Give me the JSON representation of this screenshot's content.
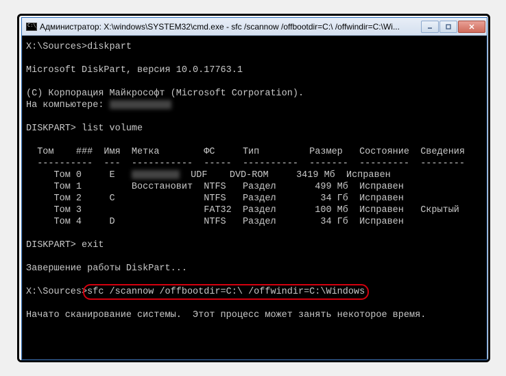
{
  "window": {
    "title": "Администратор: X:\\windows\\SYSTEM32\\cmd.exe - sfc /scannow /offbootdir=C:\\ /offwindir=C:\\Wi..."
  },
  "terminal": {
    "prompt1": "X:\\Sources>",
    "cmd1": "diskpart",
    "diskpart_header": "Microsoft DiskPart, версия 10.0.17763.1",
    "copyright": "(C) Корпорация Майкрософт (Microsoft Corporation).",
    "on_computer_label": "На компьютере: ",
    "diskpart_prompt1": "DISKPART> ",
    "diskpart_cmd1": "list volume",
    "table_header": "  Том    ###  Имя  Метка        ФС     Тип         Размер   Состояние  Сведения",
    "table_separator": "  ----------  ---  -----------  -----  ----------  -------  ---------  --------",
    "rows": [
      {
        "text_before": "     Том 0     E   ",
        "text_after": "  UDF    DVD-ROM     3419 Мб  Исправен"
      },
      {
        "text_before": "     Том 1         Восстановит  NTFS   Раздел       499 Мб  Исправен",
        "text_after": ""
      },
      {
        "text_before": "     Том 2     C                NTFS   Раздел        34 Гб  Исправен",
        "text_after": ""
      },
      {
        "text_before": "     Том 3                      FAT32  Раздел       100 Мб  Исправен   Скрытый",
        "text_after": ""
      },
      {
        "text_before": "     Том 4     D                NTFS   Раздел        34 Гб  Исправен",
        "text_after": ""
      }
    ],
    "diskpart_prompt2": "DISKPART> ",
    "diskpart_cmd2": "exit",
    "exit_msg": "Завершение работы DiskPart...",
    "prompt2": "X:\\Sources>",
    "cmd2": "sfc /scannow /offbootdir=C:\\ /offwindir=C:\\Windows",
    "scan_msg": "Начато сканирование системы.  Этот процесс может занять некоторое время."
  }
}
